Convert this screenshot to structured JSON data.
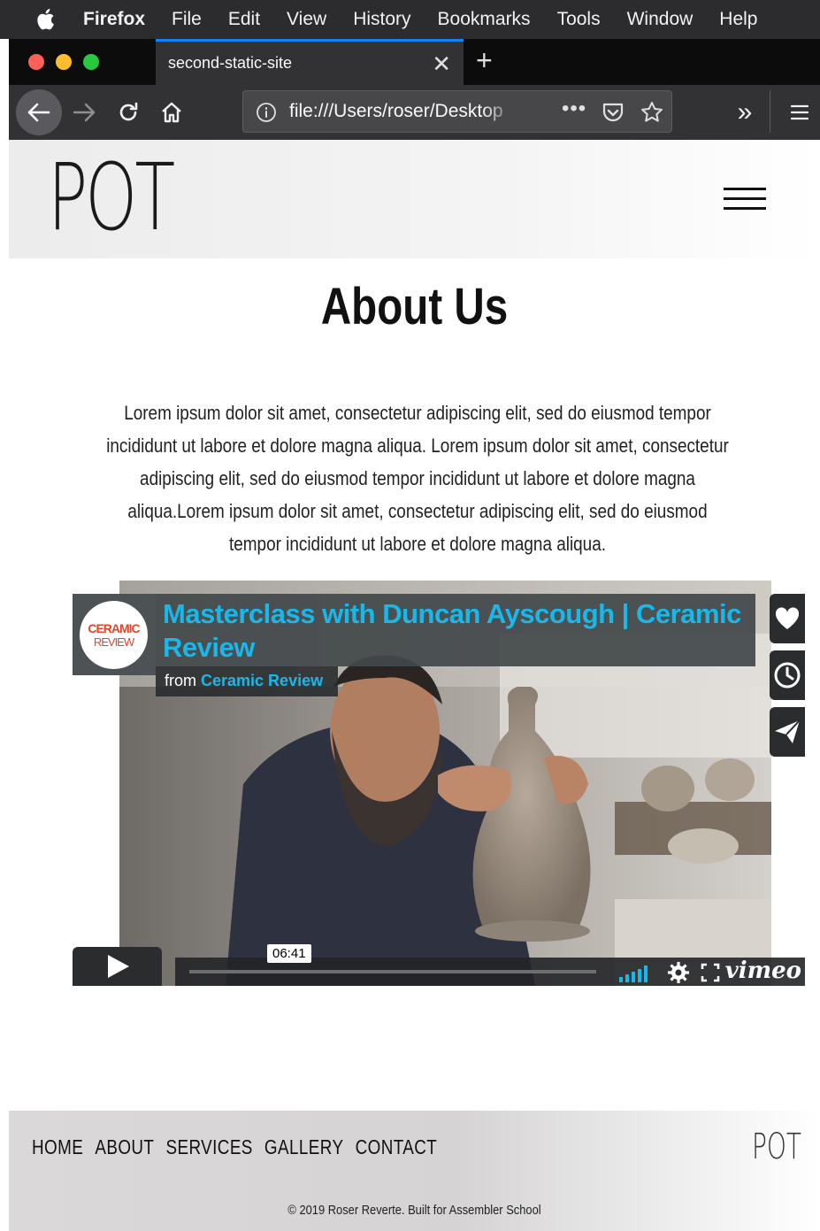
{
  "menubar": {
    "app": "Firefox",
    "items": [
      "File",
      "Edit",
      "View",
      "History",
      "Bookmarks",
      "Tools",
      "Window",
      "Help"
    ]
  },
  "browser": {
    "tab_title": "second-static-site",
    "url": "file:///Users/roser/Desktop"
  },
  "site": {
    "logo": "POT",
    "page_title": "About Us",
    "intro": "Lorem ipsum dolor sit amet, consectetur adipiscing elit, sed do eiusmod tempor incididunt ut labore et dolore magna aliqua. Lorem ipsum dolor sit amet, consectetur adipiscing elit, sed do eiusmod tempor incididunt ut labore et dolore magna aliqua.Lorem ipsum dolor sit amet, consectetur adipiscing elit, sed do eiusmod tempor incididunt ut labore et dolore magna aliqua."
  },
  "video": {
    "channel_logo_line1": "CERAMIC",
    "channel_logo_line2": "REVIEW",
    "title": "Masterclass with Duncan Ayscough | Ceramic Review",
    "from_label": "from",
    "from_channel": "Ceramic Review",
    "duration": "06:41",
    "brand": "vimeo"
  },
  "footer": {
    "nav": [
      "HOME",
      "ABOUT",
      "SERVICES",
      "GALLERY",
      "CONTACT"
    ],
    "logo": "POT",
    "copyright": "© 2019 Roser Reverte. Built for Assembler School"
  },
  "colors": {
    "accent_blue": "#0a84ff",
    "vimeo_blue": "#1ab7ea",
    "traffic_red": "#fe5f57",
    "traffic_yellow": "#febc2e",
    "traffic_green": "#28c840"
  }
}
